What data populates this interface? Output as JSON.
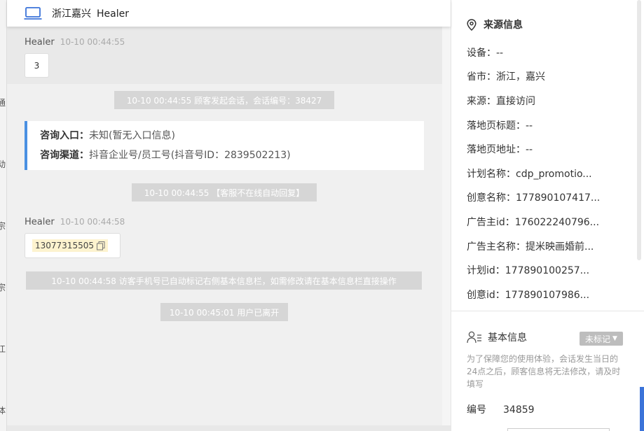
{
  "header": {
    "location": "浙江嘉兴",
    "name": "Healer"
  },
  "messages": {
    "first": {
      "sender": "Healer",
      "time": "10-10 00:44:55",
      "text": "3"
    },
    "sys1": "10-10 00:44:55 顾客发起会话，会话编号：38427",
    "card": {
      "entry_label": "咨询入口：",
      "entry_value": "未知(暂无入口信息)",
      "channel_label": "咨询渠道：",
      "channel_value": "抖音企业号/员工号(抖音号ID：2839502213)"
    },
    "sys2": "10-10 00:44:55 【客服不在线自动回复】",
    "second": {
      "sender": "Healer",
      "time": "10-10 00:44:58",
      "phone": "13077315505"
    },
    "sys3": "10-10 00:44:58 访客手机号已自动标记右侧基本信息栏，如需修改请在基本信息栏直接操作",
    "sys4": "10-10 00:45:01 用户已离开"
  },
  "source_info": {
    "title": "来源信息",
    "fields": [
      "设备：--",
      "省市：浙江，嘉兴",
      "来源：直接访问",
      "落地页标题：--",
      "落地页地址：--",
      "计划名称：cdp_promotio...",
      "创意名称：177890107417...",
      "广告主id：176022240796...",
      "广告主名称：提米映画婚前...",
      "计划id：177890100257...",
      "创意id：177890107986..."
    ]
  },
  "basic_info": {
    "title": "基本信息",
    "tag_button": "未标记",
    "notice": "为了保障您的使用体验，会话发生当日的24点之后，顾客信息将无法修改，请及时填写",
    "number_label": "编号",
    "number_value": "34859"
  },
  "background_fragments": [
    "通",
    "动",
    "宗",
    "宗",
    "江",
    "体"
  ],
  "colors": {
    "accent_blue": "#4a90e2",
    "system_msg_bg": "#d6d6d6",
    "phone_highlight": "#fdf3cf",
    "tag_gray": "#bdbdbd"
  }
}
